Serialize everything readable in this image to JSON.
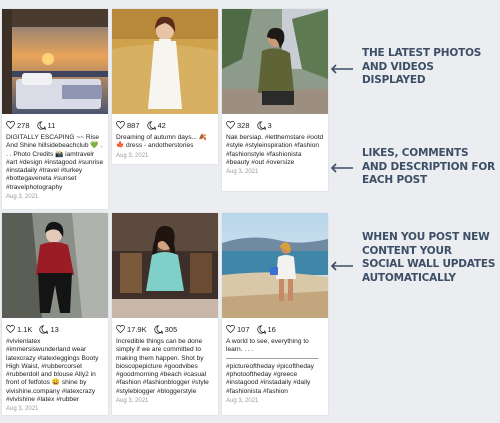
{
  "posts": [
    {
      "likes": "278",
      "comments": "11",
      "caption": "DIGITALLY ESCAPING ~~ Rise And Shine hillsidebeachclub 💚 . . . Photo Credits 📸 iamtravelr #art #design #instagood #sunrise #instadaily #travel #turkey #bottegaveneta #sunset #travelphotography",
      "date": "Aug 3, 2021"
    },
    {
      "likes": "887",
      "comments": "42",
      "caption": "Dreaming of autumn days... 🍂🍁 dress - andotherstories",
      "date": "Aug 3, 2021"
    },
    {
      "likes": "328",
      "comments": "3",
      "caption": "Nak bersiap. #letthemstare #ootd #style #styleinspiration #fashion #fashionstyle #fashionista #beauty #out #oversize",
      "date": "Aug 3, 2021"
    },
    {
      "likes": "1.1K",
      "comments": "13",
      "caption": "#vivienlatex\n#immersiswunderland wear latexcrazy #latexleggings Booty High Waist, #rubbercorset #rubberdoll and blouse Ally2 in front of fetfotos 😀 shine by vivishine.company #latexcrazy #vivishine #latex #rubber",
      "date": "Aug 3, 2021"
    },
    {
      "likes": "17.9K",
      "comments": "305",
      "caption": "Incredible things can be done simply if we are committed to making them happen. Shot by bioscopepicture #goodvibes #goodmorning #beach #casual #fashion #fashionblogger #style #styleblogger #bloggerstyle",
      "date": "Aug 3, 2021"
    },
    {
      "likes": "107",
      "comments": "16",
      "caption": "A world to see, everything to learn. . . .\n——————————————\n#pictureoftheday #picoftheday #photooftheday #greece #instagood #instadaily #daily #fashionista #fashion",
      "date": "Aug 3, 2021"
    }
  ],
  "annotations": [
    {
      "text": "THE LATEST PHOTOS AND VIDEOS DISPLAYED"
    },
    {
      "text": "LIKES, COMMENTS AND DESCRIPTION FOR EACH POST"
    },
    {
      "text": "WHEN YOU POST NEW CONTENT YOUR SOCIAL WALL UPDATES AUTOMATICALLY"
    }
  ],
  "colors": {
    "background": "#ecedf0",
    "annotation_text": "#3c4f66",
    "date_text": "#9a9a9a"
  },
  "icons": {
    "likes": "heart-icon",
    "comments": "comment-bubble-icon",
    "annotation_arrow": "arrow-left-icon"
  }
}
